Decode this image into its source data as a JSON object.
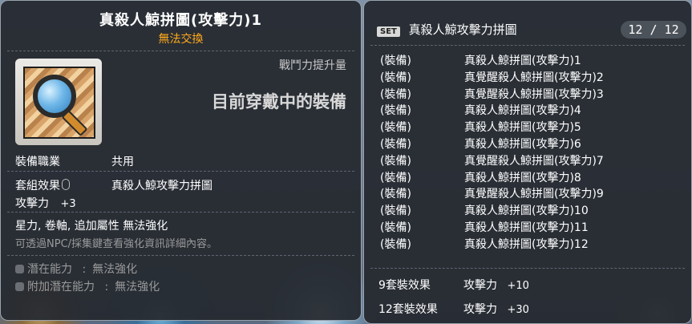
{
  "left": {
    "item_name": "真殺人鯨拼圖(攻擊力)1",
    "trade_status": "無法交換",
    "power_label": "戰鬥力提升量",
    "equipped_text": "目前穿戴中的裝備",
    "job_label": "裝備職業",
    "job_value": "共用",
    "set_effect_label": "套組效果",
    "set_effect_value": "真殺人鯨攻擊力拼圖",
    "stat_label": "攻擊力",
    "stat_value": "+3",
    "enhance_text": "星力, 卷軸, 追加屬性 無法強化",
    "npc_hint": "可透過NPC/採集鍵查看強化資訊詳細內容。",
    "potential": {
      "label": "潛在能力",
      "sep": ":",
      "value": "無法強化"
    },
    "bonus_potential": {
      "label": "附加潛在能力",
      "sep": ":",
      "value": "無法強化"
    }
  },
  "right": {
    "set_badge": "SET",
    "set_name": "真殺人鯨攻擊力拼圖",
    "count": "12 / 12",
    "items": [
      {
        "slot": "(裝備)",
        "name": "真殺人鯨拼圖(攻擊力)1"
      },
      {
        "slot": "(裝備)",
        "name": "真覺醒殺人鯨拼圖(攻擊力)2"
      },
      {
        "slot": "(裝備)",
        "name": "真覺醒殺人鯨拼圖(攻擊力)3"
      },
      {
        "slot": "(裝備)",
        "name": "真殺人鯨拼圖(攻擊力)4"
      },
      {
        "slot": "(裝備)",
        "name": "真殺人鯨拼圖(攻擊力)5"
      },
      {
        "slot": "(裝備)",
        "name": "真殺人鯨拼圖(攻擊力)6"
      },
      {
        "slot": "(裝備)",
        "name": "真覺醒殺人鯨拼圖(攻擊力)7"
      },
      {
        "slot": "(裝備)",
        "name": "真殺人鯨拼圖(攻擊力)8"
      },
      {
        "slot": "(裝備)",
        "name": "真覺醒殺人鯨拼圖(攻擊力)9"
      },
      {
        "slot": "(裝備)",
        "name": "真殺人鯨拼圖(攻擊力)10"
      },
      {
        "slot": "(裝備)",
        "name": "真殺人鯨拼圖(攻擊力)11"
      },
      {
        "slot": "(裝備)",
        "name": "真殺人鯨拼圖(攻擊力)12"
      }
    ],
    "bonuses": [
      {
        "label": "9套裝效果",
        "stat": "攻擊力",
        "value": "+10"
      },
      {
        "label": "12套裝效果",
        "stat": "攻擊力",
        "value": "+30"
      }
    ]
  }
}
